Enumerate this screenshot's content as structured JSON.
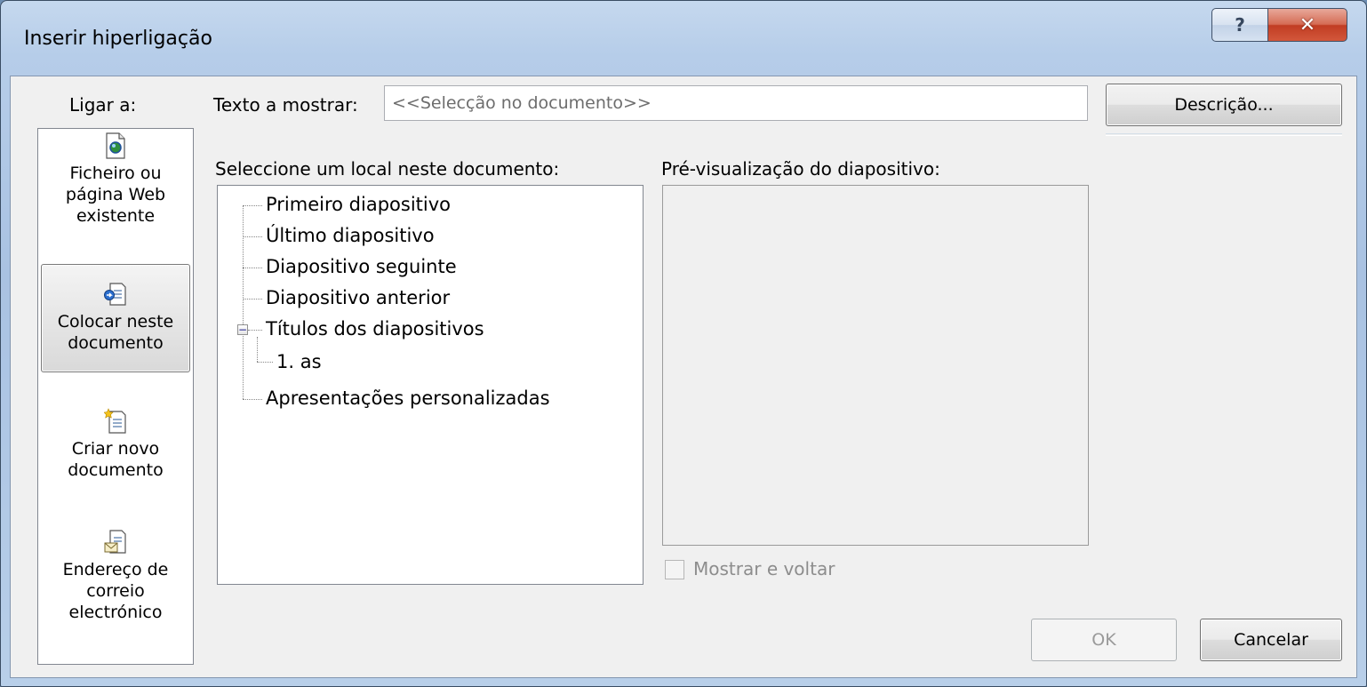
{
  "window": {
    "title": "Inserir hiperligação",
    "help_glyph": "?",
    "close_glyph": "✕"
  },
  "link_to": {
    "label": "Ligar a:",
    "items": [
      {
        "label": "Ficheiro ou\npágina Web\nexistente",
        "icon": "web-page-icon",
        "active": false
      },
      {
        "label": "Colocar neste\ndocumento",
        "icon": "place-in-document-icon",
        "active": true
      },
      {
        "label": "Criar novo\ndocumento",
        "icon": "new-document-icon",
        "active": false
      },
      {
        "label": "Endereço de\ncorreio\nelectrónico",
        "icon": "email-address-icon",
        "active": false
      }
    ]
  },
  "text_to_display": {
    "label": "Texto a mostrar:",
    "value": "<<Selecção no documento>>"
  },
  "buttons": {
    "description": "Descrição...",
    "ok": "OK",
    "cancel": "Cancelar"
  },
  "select_place": {
    "label": "Seleccione um local neste documento:",
    "items": [
      "Primeiro diapositivo",
      "Último diapositivo",
      "Diapositivo seguinte",
      "Diapositivo anterior",
      "Títulos dos diapositivos",
      "1. as",
      "Apresentações personalizadas"
    ]
  },
  "preview": {
    "label": "Pré-visualização do diapositivo:",
    "show_and_return_label": "Mostrar e voltar"
  },
  "colors": {
    "accent_close": "#c13d23",
    "titlebar": "#b6cde9"
  }
}
